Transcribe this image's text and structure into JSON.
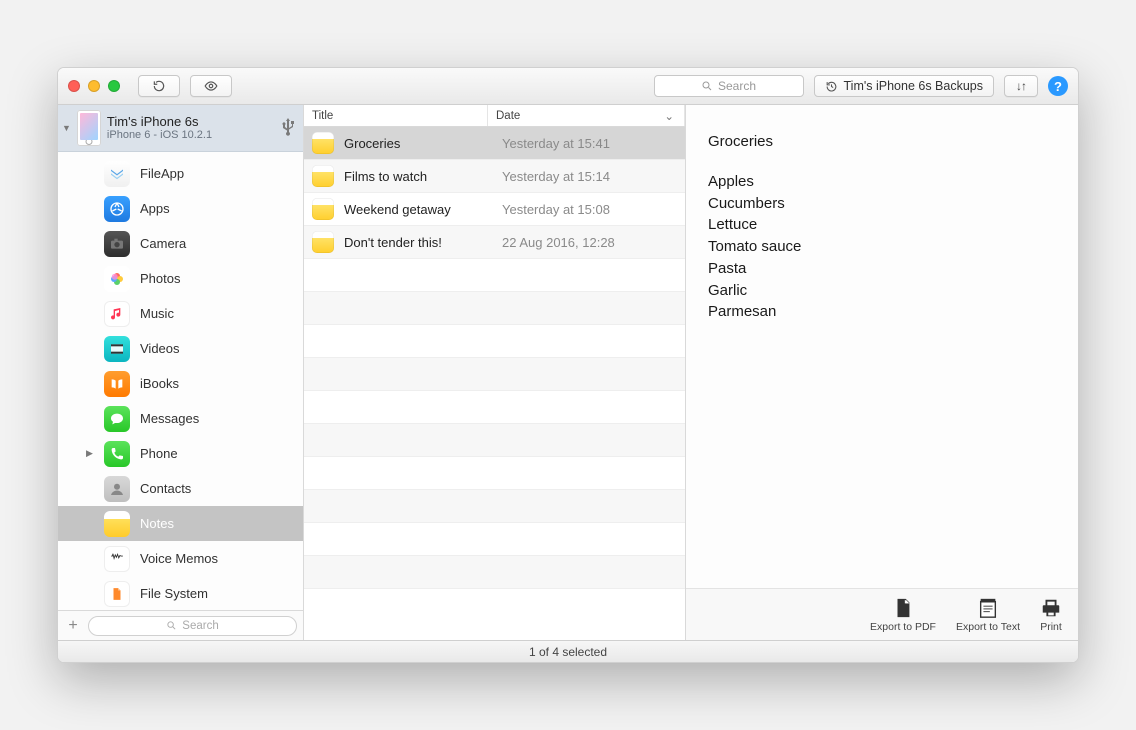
{
  "toolbar": {
    "search_placeholder": "Search",
    "backups_label": "Tim's iPhone 6s Backups",
    "transfer_glyph": "↓↑",
    "help_glyph": "?"
  },
  "device": {
    "name": "Tim's iPhone 6s",
    "subtitle": "iPhone 6 - iOS 10.2.1"
  },
  "sidebar": {
    "items": [
      {
        "label": "FileApp",
        "icon": "fileapp",
        "selected": false,
        "disclosure": ""
      },
      {
        "label": "Apps",
        "icon": "apps",
        "selected": false,
        "disclosure": ""
      },
      {
        "label": "Camera",
        "icon": "camera",
        "selected": false,
        "disclosure": ""
      },
      {
        "label": "Photos",
        "icon": "photos",
        "selected": false,
        "disclosure": ""
      },
      {
        "label": "Music",
        "icon": "music",
        "selected": false,
        "disclosure": ""
      },
      {
        "label": "Videos",
        "icon": "videos",
        "selected": false,
        "disclosure": ""
      },
      {
        "label": "iBooks",
        "icon": "ibooks",
        "selected": false,
        "disclosure": ""
      },
      {
        "label": "Messages",
        "icon": "messages",
        "selected": false,
        "disclosure": ""
      },
      {
        "label": "Phone",
        "icon": "phone",
        "selected": false,
        "disclosure": "▶"
      },
      {
        "label": "Contacts",
        "icon": "contacts",
        "selected": false,
        "disclosure": ""
      },
      {
        "label": "Notes",
        "icon": "notes",
        "selected": true,
        "disclosure": ""
      },
      {
        "label": "Voice Memos",
        "icon": "voice",
        "selected": false,
        "disclosure": ""
      },
      {
        "label": "File System",
        "icon": "files",
        "selected": false,
        "disclosure": ""
      }
    ],
    "search_placeholder": "Search"
  },
  "columns": {
    "title": "Title",
    "date": "Date"
  },
  "notes": [
    {
      "title": "Groceries",
      "date": "Yesterday at 15:41",
      "selected": true
    },
    {
      "title": "Films to watch",
      "date": "Yesterday at 15:14",
      "selected": false
    },
    {
      "title": "Weekend getaway",
      "date": "Yesterday at 15:08",
      "selected": false
    },
    {
      "title": "Don't tender this!",
      "date": "22 Aug 2016, 12:28",
      "selected": false
    }
  ],
  "detail": {
    "title": "Groceries",
    "lines": [
      "Apples",
      "Cucumbers",
      "Lettuce",
      "Tomato sauce",
      "Pasta",
      "Garlic",
      "Parmesan"
    ]
  },
  "actions": {
    "pdf": "Export to PDF",
    "txt": "Export to Text",
    "print": "Print"
  },
  "status": "1 of 4 selected"
}
